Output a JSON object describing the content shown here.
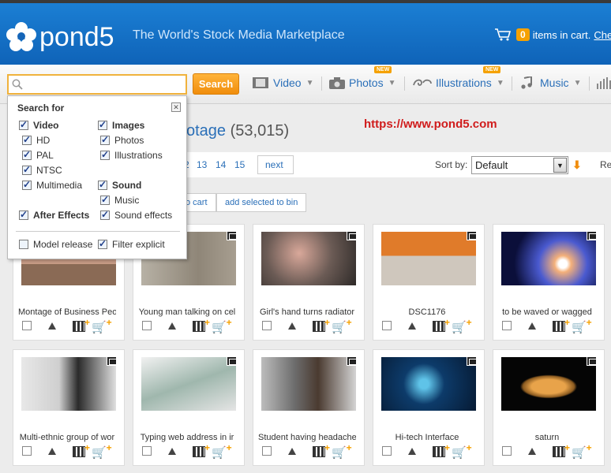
{
  "header": {
    "brand": "pond5",
    "tagline": "The World's Stock Media Marketplace",
    "cart_count": "0",
    "cart_text": "items in cart.",
    "cart_link": "Chec"
  },
  "search": {
    "value": "",
    "button_label": "Search"
  },
  "nav": {
    "items": [
      {
        "label": "Video",
        "icon": "film-icon",
        "new": false
      },
      {
        "label": "Photos",
        "icon": "camera-icon",
        "new": true
      },
      {
        "label": "Illustrations",
        "icon": "swirl-icon",
        "new": true
      },
      {
        "label": "Music",
        "icon": "music-note-icon",
        "new": false
      }
    ],
    "new_label": "NEW"
  },
  "main": {
    "title_partial": "otage",
    "count": "(53,015)",
    "url_overlay": "https://www.pond5.com",
    "pages": [
      "2",
      "13",
      "14",
      "15"
    ],
    "next_label": "next",
    "sort_label": "Sort by:",
    "sort_value": "Default",
    "rel_partial": "Re",
    "actions": [
      "o cart",
      "add selected to bin"
    ]
  },
  "dropdown": {
    "title": "Search for",
    "video": "Video",
    "hd": "HD",
    "pal": "PAL",
    "ntsc": "NTSC",
    "multimedia": "Multimedia",
    "after_effects": "After Effects",
    "images": "Images",
    "photos": "Photos",
    "illustrations": "Illustrations",
    "sound": "Sound",
    "music": "Music",
    "sound_effects": "Sound effects",
    "model_release": "Model release",
    "filter_explicit": "Filter explicit"
  },
  "cards": [
    {
      "title": "Montage of Business Peo"
    },
    {
      "title": "Young man talking on cel"
    },
    {
      "title": "Girl's hand turns radiator"
    },
    {
      "title": "DSC1176"
    },
    {
      "title": "to be waved or wagged"
    },
    {
      "title": "Multi-ethnic group of wor"
    },
    {
      "title": "Typing web address in ir"
    },
    {
      "title": "Student having headache"
    },
    {
      "title": "Hi-tech Interface"
    },
    {
      "title": "saturn"
    }
  ],
  "colors": {
    "header_blue": "#1b7fd4",
    "accent_orange": "#f5a100",
    "link_blue": "#2a6fb8",
    "url_red": "#d01c1c"
  }
}
